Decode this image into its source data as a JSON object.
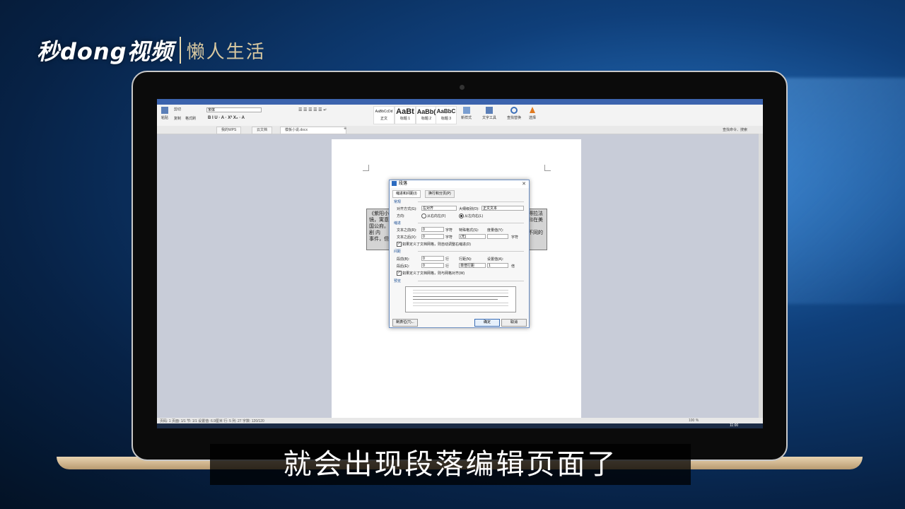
{
  "brand": {
    "logo": "秒dong视频",
    "slogan": "懒人生活"
  },
  "ribbon": {
    "paste": "粘贴",
    "cut": "剪切",
    "copy": "复制",
    "format_painter": "格式刷",
    "font": "宋体",
    "styles": [
      {
        "sample": "AaBbCcDd",
        "name": "正文"
      },
      {
        "sample": "AaBt",
        "name": "标题 1"
      },
      {
        "sample": "AaBb(",
        "name": "标题 2"
      },
      {
        "sample": "AaBbC",
        "name": "标题 3"
      }
    ],
    "new_style": "新样式",
    "text_tools": "文字工具",
    "find_replace": "查找替换",
    "select": "选择",
    "search": "查找命令、搜索"
  },
  "doc_tabs": [
    "我的WPS",
    "云文档",
    "模板小说.docx"
  ],
  "textbox_lines": [
    "《紫阳小",
    "镜，寓意",
    "国公府。",
    "剧 内",
    "事件，但"
  ],
  "textbox_right": [
    "得拉法",
    "曰在美",
    "不同的"
  ],
  "dialog": {
    "title": "段落",
    "tab_indent": "缩进和间距(I)",
    "tab_linebreak": "换行和分页(P)",
    "sec_general": "常规",
    "align_label": "对齐方式(G):",
    "align_value": "左对齐",
    "outline_label": "大纲级别(O):",
    "outline_value": "正文文本",
    "direction_label": "方向:",
    "rtl": "从右向左(F)",
    "ltr": "从左向右(L)",
    "sec_indent": "缩进",
    "before_text": "文本之前(R):",
    "before_value": "0",
    "unit_char": "字符",
    "special_label": "特殊格式(S):",
    "special_value": "(无)",
    "measure_label": "度量值(Y):",
    "after_text": "文本之后(X):",
    "after_value": "0",
    "auto_indent": "如果定义了文档网格，则自动调整右缩进(D)",
    "sec_spacing": "间距",
    "before_para": "段前(B):",
    "before_para_value": "0",
    "unit_line": "行",
    "line_spacing_label": "行距(N):",
    "line_spacing_value": "单倍行距",
    "set_value_label": "设置值(A):",
    "set_value": "1",
    "unit_times": "倍",
    "after_para": "段后(E):",
    "after_para_value": "0",
    "snap_grid": "如果定义了文档网格，则与网格对齐(W)",
    "sec_preview": "预览",
    "tabs_btn": "制表位(T)...",
    "ok": "确定",
    "cancel": "取消"
  },
  "statusbar": {
    "left": "页码: 1  页面: 1/1  节: 1/1  设置值: 6.9厘米  行: 5  列: 27  字数: 120/120",
    "zoom": "100 %"
  },
  "taskbar": {
    "time": "11:00"
  },
  "subtitle": "就会出现段落编辑页面了"
}
